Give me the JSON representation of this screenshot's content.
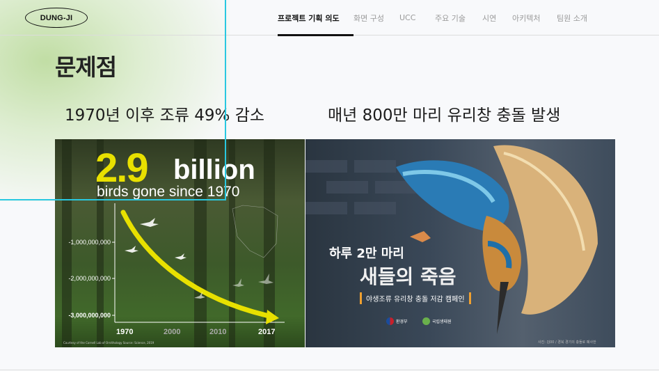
{
  "header": {
    "logo": "DUNG-JI",
    "nav": [
      {
        "label": "프로젝트 기획 의도",
        "active": true
      },
      {
        "label": "화면 구성",
        "active": false
      },
      {
        "label": "UCC",
        "active": false
      },
      {
        "label": "주요 기술",
        "active": false
      },
      {
        "label": "시연",
        "active": false
      },
      {
        "label": "아키텍처",
        "active": false
      },
      {
        "label": "팀원 소개",
        "active": false
      }
    ]
  },
  "section_title": "문제점",
  "captions": [
    "1970년 이후 조류 49% 감소",
    "매년 800만 마리 유리창 충돌 발생"
  ],
  "image_left": {
    "headline_number": "2.9",
    "headline_unit": "billion",
    "subtitle": "birds gone since 1970",
    "y_ticks": [
      "-1,000,000,000",
      "-2,000,000,000",
      "-3,000,000,000"
    ],
    "x_ticks": [
      "1970",
      "2000",
      "2010",
      "2017"
    ],
    "credit": "Courtesy of the Cornell Lab of Ornithology  Source: Science, 2019"
  },
  "image_right": {
    "title_line1": "하루 2만 마리",
    "title_line2": "새들의 죽음",
    "campaign": "야생조류 유리창 충돌 저감 캠페인",
    "orgs": [
      "환경부",
      "국립생태원"
    ],
    "photo_credit": "사진: 김00 / 경북 경기의 충돌로 폐사한"
  },
  "colors": {
    "accent_yellow": "#e8e000",
    "guide_line": "#29c8e0",
    "campaign_bar": "#f0a030"
  }
}
